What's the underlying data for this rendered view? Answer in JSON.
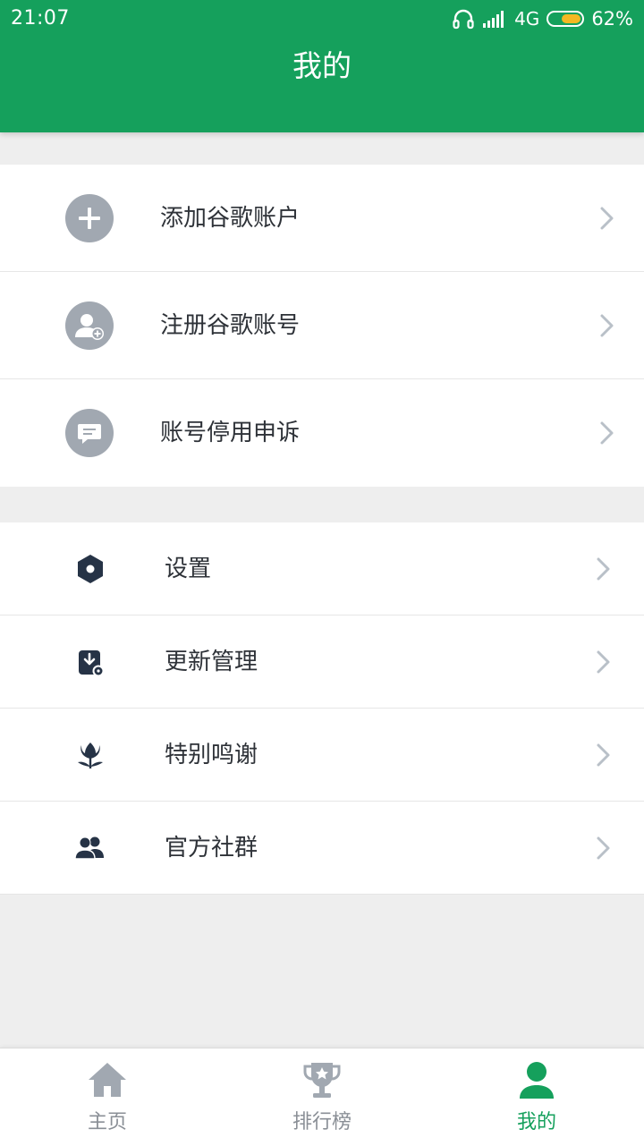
{
  "status_bar": {
    "time": "21:07",
    "network": "4G",
    "battery_percent": "62%",
    "battery_level": 0.62
  },
  "header": {
    "title": "我的"
  },
  "account_section": {
    "items": [
      {
        "label": "添加谷歌账户",
        "icon": "add-circle-icon"
      },
      {
        "label": "注册谷歌账号",
        "icon": "add-user-icon"
      },
      {
        "label": "账号停用申诉",
        "icon": "message-icon"
      }
    ]
  },
  "settings_section": {
    "items": [
      {
        "label": "设置",
        "icon": "settings-hex-icon"
      },
      {
        "label": "更新管理",
        "icon": "download-update-icon"
      },
      {
        "label": "特别鸣谢",
        "icon": "tulip-icon"
      },
      {
        "label": "官方社群",
        "icon": "group-icon"
      }
    ]
  },
  "tabbar": {
    "tabs": [
      {
        "label": "主页",
        "icon": "home-icon",
        "active": false
      },
      {
        "label": "排行榜",
        "icon": "trophy-icon",
        "active": false
      },
      {
        "label": "我的",
        "icon": "person-icon",
        "active": true
      }
    ]
  },
  "colors": {
    "brand_green": "#15a05c",
    "icon_gray": "#a1a8b1",
    "icon_dark": "#263346",
    "text": "#2e3238",
    "inactive_tab": "#8a8f96"
  }
}
